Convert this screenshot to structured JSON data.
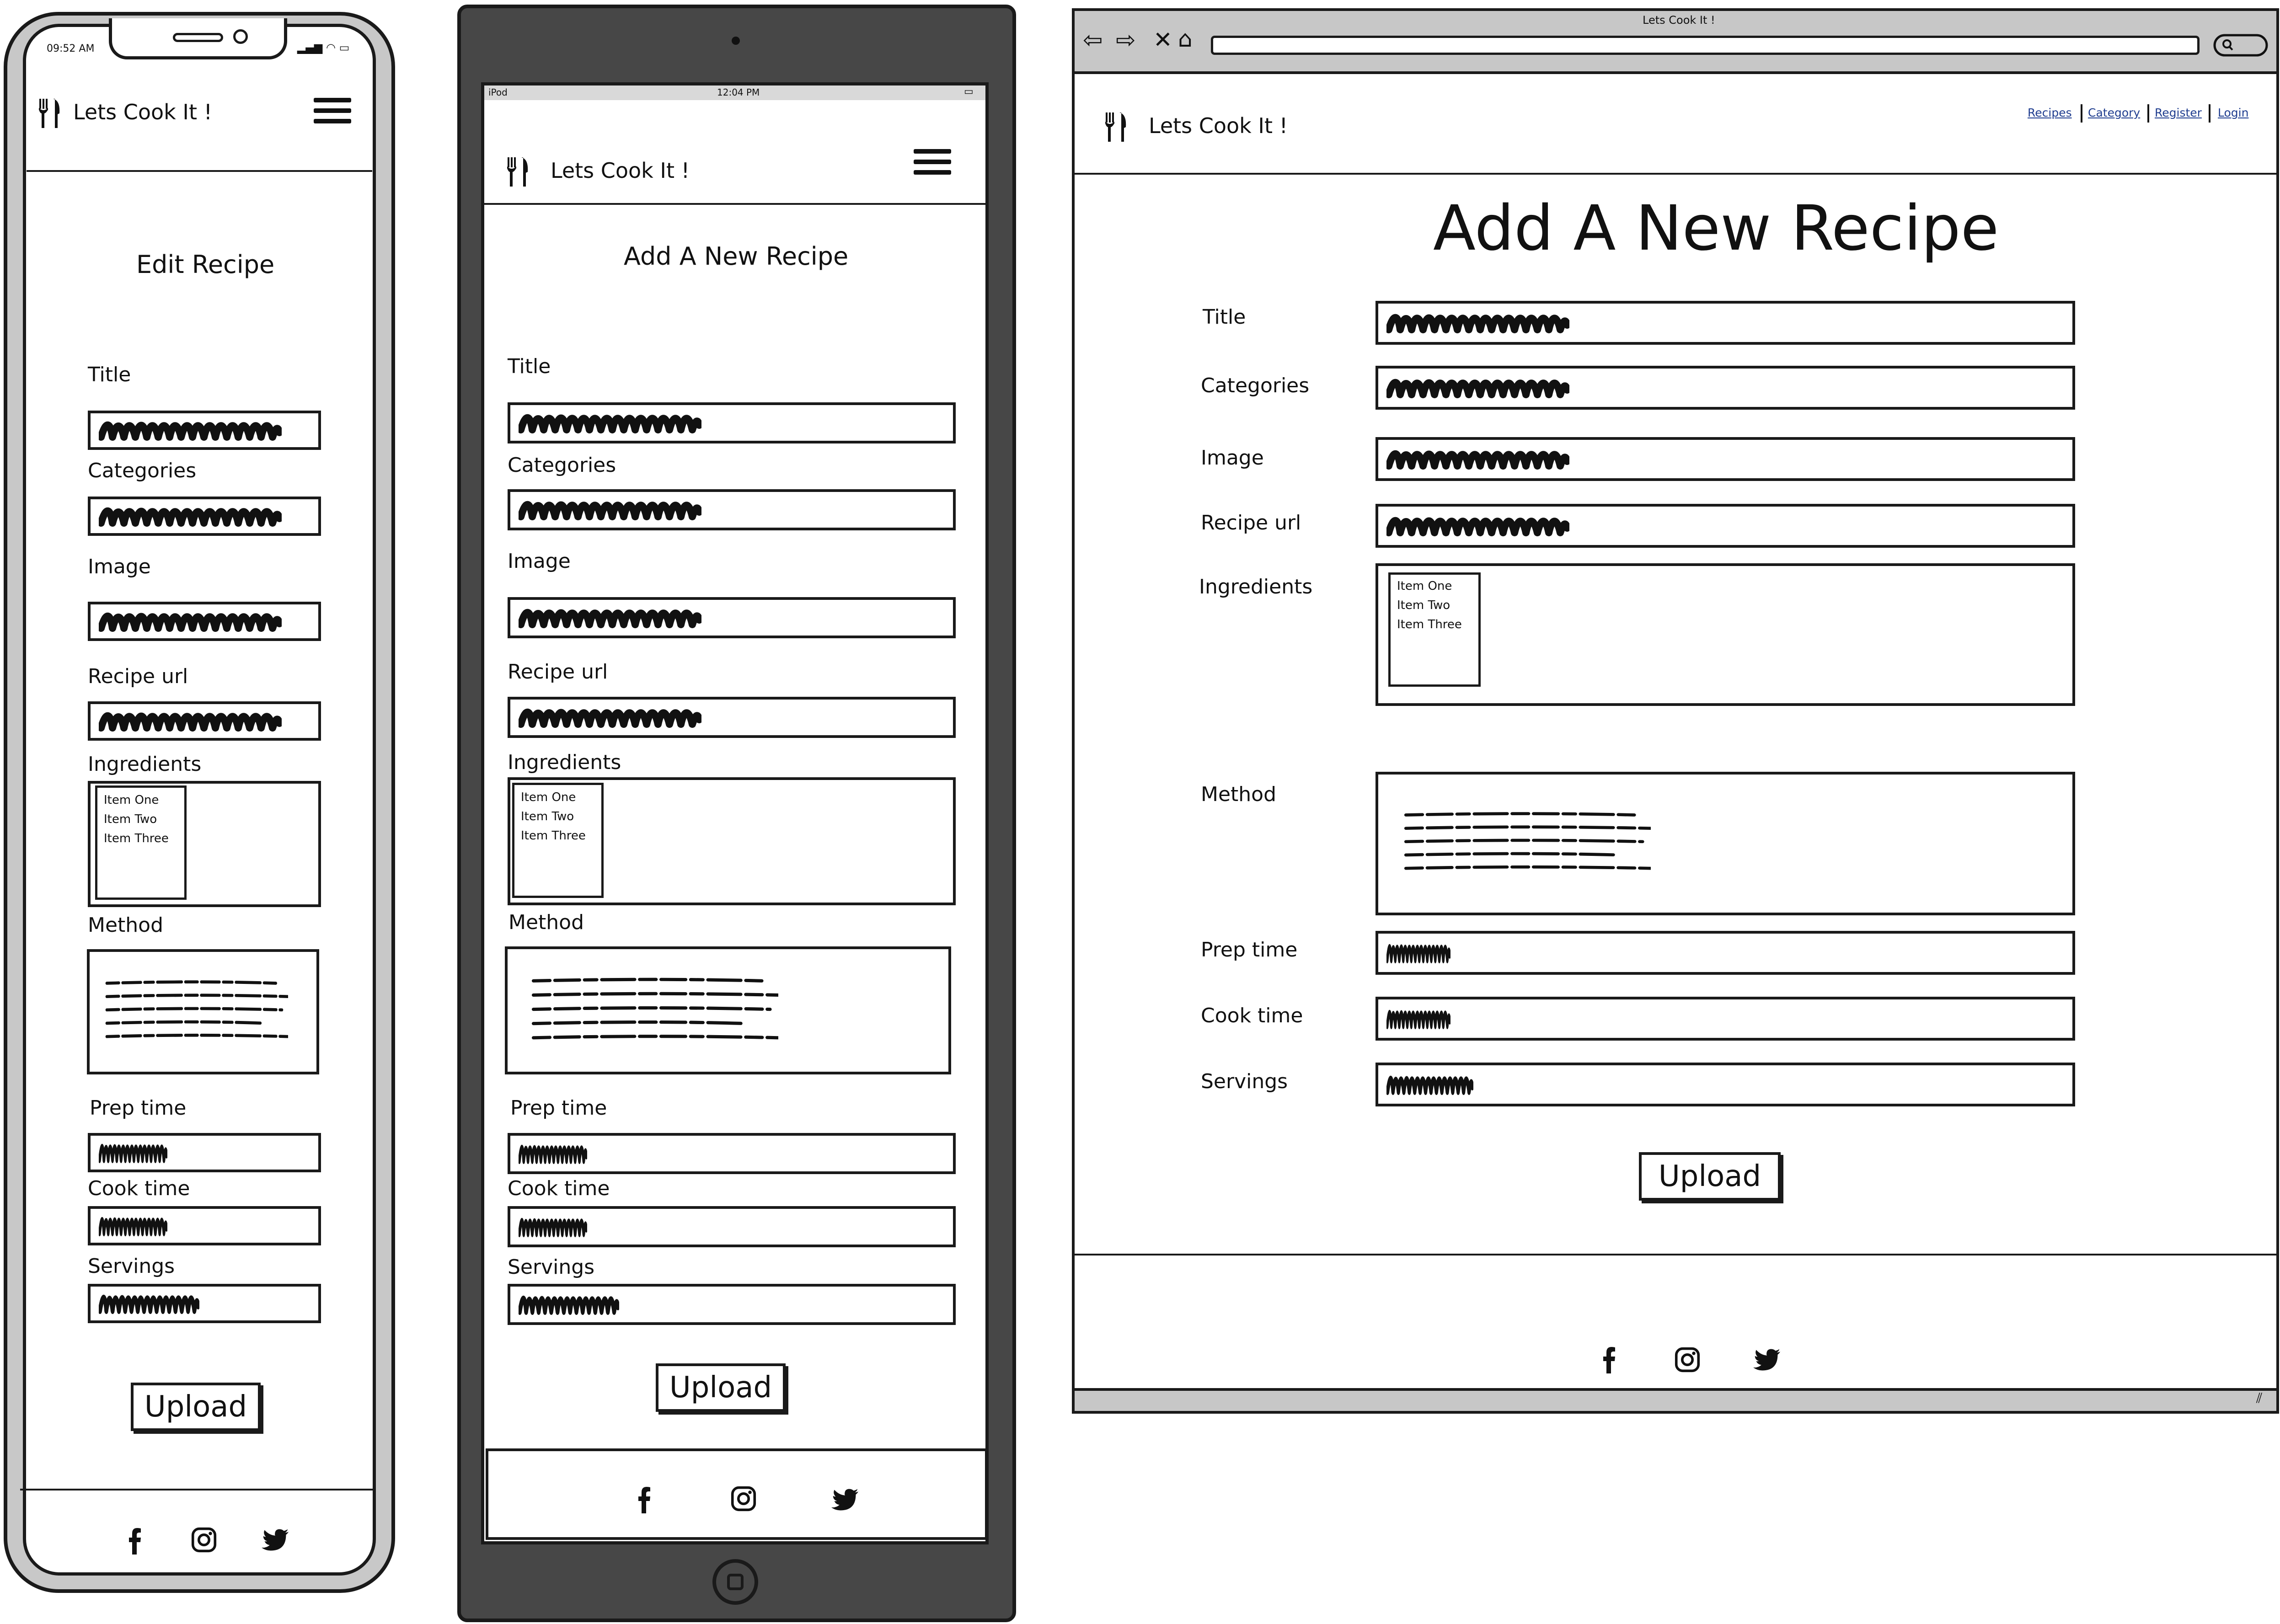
{
  "app_title": "Lets Cook It !",
  "status": {
    "phone_time": "09:52 AM",
    "tablet_carrier": "iPod",
    "tablet_time": "12:04 PM"
  },
  "browser": {
    "window_title": "Lets Cook It !",
    "nav_links": [
      "Recipes",
      "Category",
      "Register",
      "Login"
    ]
  },
  "pages": {
    "phone_heading": "Edit Recipe",
    "tablet_heading": "Add A New Recipe",
    "desktop_heading": "Add A New Recipe"
  },
  "form": {
    "labels": {
      "title": "Title",
      "categories": "Categories",
      "image": "Image",
      "recipe_url": "Recipe url",
      "ingredients": "Ingredients",
      "method": "Method",
      "prep_time": "Prep time",
      "cook_time": "Cook time",
      "servings": "Servings"
    },
    "ingredient_items": [
      "Item One",
      "Item Two",
      "Item Three"
    ],
    "upload_label": "Upload"
  },
  "footer_icons": [
    "facebook-icon",
    "instagram-icon",
    "twitter-icon"
  ],
  "colors": {
    "ink": "#1a1a1a",
    "tablet_frame": "#474747",
    "phone_frame": "#c8c8c8",
    "browser_chrome": "#c7c7c7",
    "link": "#1f3d8f"
  }
}
